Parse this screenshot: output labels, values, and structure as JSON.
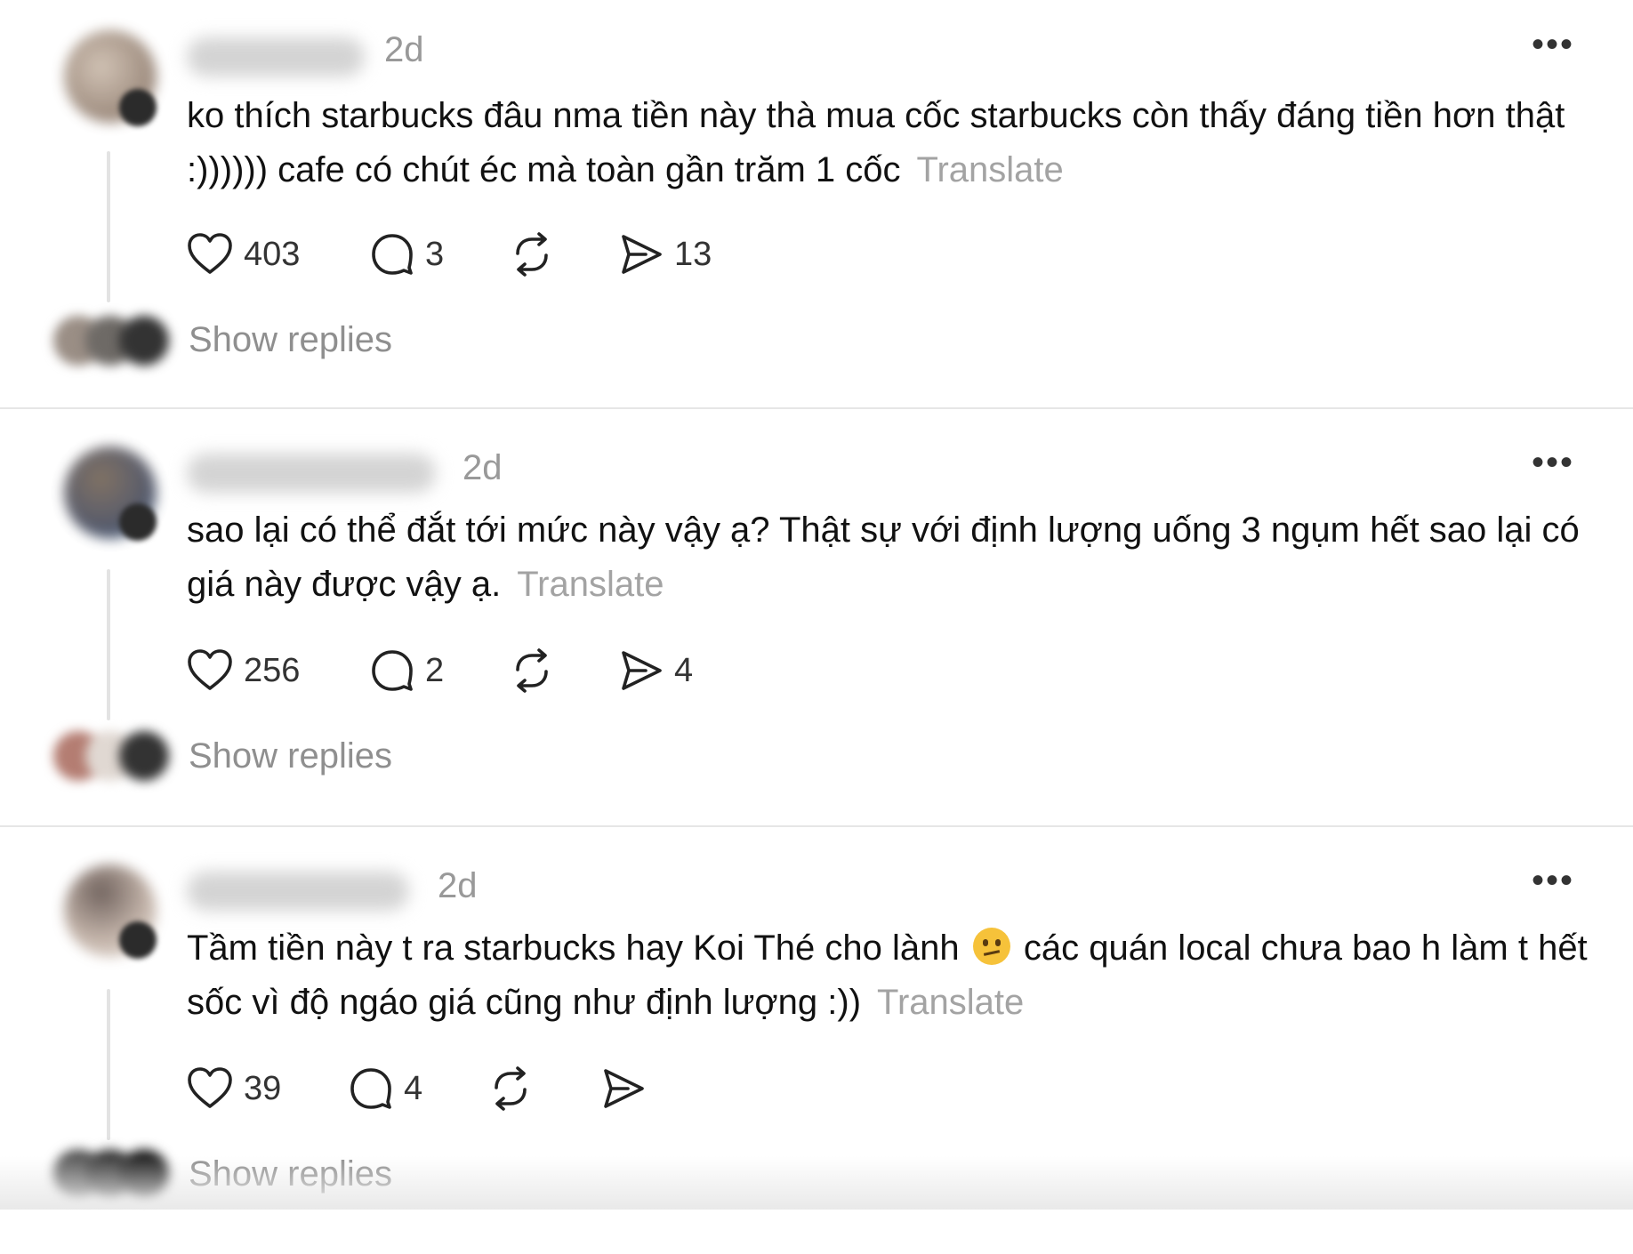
{
  "theme": {
    "background": "#ffffff",
    "text": "#111111",
    "muted": "#999999",
    "translate": "#a3a3a3",
    "divider": "#e6e6e6"
  },
  "icons": {
    "like": "heart-icon",
    "comment": "comment-bubble-icon",
    "repost": "repost-icon",
    "share": "send-icon",
    "more": "more-dots-icon",
    "emoji": "confused-face-emoji"
  },
  "more_glyph": "•••",
  "comments": [
    {
      "username": "",
      "time": "2d",
      "text": "ko thích starbucks đâu nma tiền này thà mua cốc starbucks còn thấy đáng tiền hơn thật :)))))) cafe có chút éc mà toàn gần trăm 1 cốc",
      "translate_label": "Translate",
      "likes": "403",
      "comments": "3",
      "shares": "13",
      "show_replies_label": "Show replies"
    },
    {
      "username": "",
      "time": "2d",
      "text": "sao lại có thể đắt tới mức này vậy ạ? Thật sự với định lượng uống 3 ngụm hết sao lại có giá này được vậy ạ.",
      "translate_label": "Translate",
      "likes": "256",
      "comments": "2",
      "shares": "4",
      "show_replies_label": "Show replies"
    },
    {
      "username": "",
      "time": "2d",
      "text_before_emoji": "Tầm tiền này t ra starbucks hay Koi Thé cho lành",
      "text_after_emoji": "các quán local chưa bao h làm t hết sốc vì độ ngáo giá cũng như định lượng :))",
      "translate_label": "Translate",
      "likes": "39",
      "comments": "4",
      "shares": "",
      "show_replies_label": "Show replies"
    }
  ]
}
